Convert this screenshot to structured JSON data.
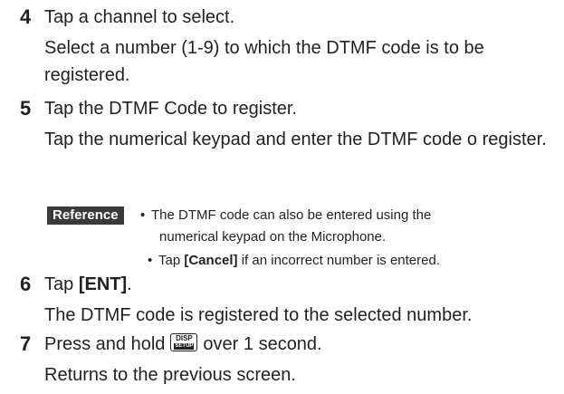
{
  "steps": [
    {
      "number": "4",
      "title": "Tap a channel to select.",
      "description": "Select a number (1-9) to which the DTMF code is to be registered."
    },
    {
      "number": "5",
      "title": "Tap the DTMF Code to register.",
      "description": "Tap the numerical keypad and enter the DTMF code o register."
    },
    {
      "number": "6",
      "title_prefix": "Tap ",
      "title_bold": "[ENT]",
      "title_suffix": ".",
      "description": "The DTMF code is registered to the selected number."
    },
    {
      "number": "7",
      "title_prefix": "Press and hold",
      "key_top": "DISP",
      "key_bottom": "SETUP",
      "title_suffix": "over 1 second.",
      "description": "Returns to the previous screen."
    }
  ],
  "reference": {
    "label": "Reference",
    "items": [
      {
        "bullet": "•",
        "line1": "The DTMF code can also be entered using the",
        "line2": "numerical keypad on the Microphone."
      },
      {
        "bullet": "•",
        "prefix": "Tap ",
        "bold": "[Cancel]",
        "suffix": " if an incorrect number is entered."
      }
    ]
  },
  "icons": {
    "disp_setup_key": "disp-setup-key-icon"
  }
}
